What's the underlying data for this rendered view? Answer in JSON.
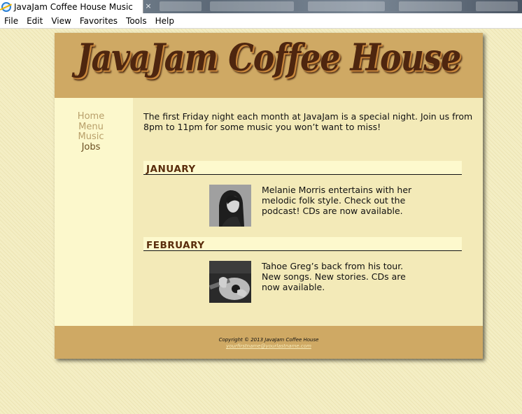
{
  "browser": {
    "tab_title": "JavaJam Coffee House Music",
    "menu": [
      "File",
      "Edit",
      "View",
      "Favorites",
      "Tools",
      "Help"
    ],
    "close_glyph": "×"
  },
  "site": {
    "logo": "JavaJam Coffee House",
    "nav": [
      {
        "label": "Home"
      },
      {
        "label": "Menu"
      },
      {
        "label": "Music"
      },
      {
        "label": "Jobs"
      }
    ],
    "intro": "The first Friday night each month at JavaJam is a special night. Join us from 8pm to 11pm for some music you won’t want to miss!",
    "events": [
      {
        "month": "JANUARY",
        "text": "Melanie Morris entertains with her melodic folk style. Check out the podcast! CDs are now available.",
        "thumb_icon": "singer-photo"
      },
      {
        "month": "FEBRUARY",
        "text": "Tahoe Greg’s back from his tour. New songs. New stories. CDs are now available.",
        "thumb_icon": "guitar-photo"
      }
    ],
    "footer": {
      "copyright": "Copyright © 2013 JavaJam Coffee House",
      "email": "yourfirstname@yourlastname.com"
    }
  },
  "colors": {
    "header_bg": "#cfa964",
    "nav_bg": "#fcf8cc",
    "content_bg": "#f3eab8",
    "month_text": "#5a2d0c",
    "logo_text": "#4e260f"
  }
}
